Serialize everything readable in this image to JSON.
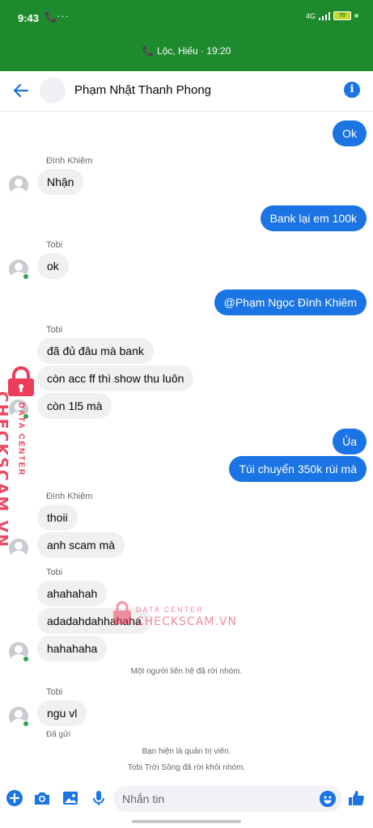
{
  "status_bar": {
    "time": "9:43",
    "network": "4G",
    "battery": "70"
  },
  "call_banner": {
    "text": "Lộc, Hiếu · 19:20"
  },
  "header": {
    "title": "Phạm Nhật Thanh Phong",
    "icons": [
      "back-arrow-icon",
      "info-icon"
    ]
  },
  "messages": [
    {
      "side": "out",
      "text": "Ok"
    },
    {
      "side": "in",
      "sender": "Đình Khiêm",
      "text": "Nhận"
    },
    {
      "side": "out",
      "text": "Bank lại em 100k"
    },
    {
      "side": "in",
      "sender": "Tobi",
      "text": "ok"
    },
    {
      "side": "out",
      "text": "@Phạm Ngọc Đình Khiêm"
    },
    {
      "side": "in",
      "sender": "Tobi",
      "text": "đã đủ đâu mà bank"
    },
    {
      "side": "in",
      "text": "còn acc ff thì show thu luôn"
    },
    {
      "side": "in",
      "text": "còn 1l5 mà"
    },
    {
      "side": "out",
      "text": "Ủa"
    },
    {
      "side": "out",
      "text": "Túi chuyển 350k rùi mà"
    },
    {
      "side": "in",
      "sender": "Đình Khiêm",
      "text": "thoii"
    },
    {
      "side": "in",
      "text": "anh scam mà"
    },
    {
      "side": "in",
      "sender": "Tobi",
      "text": "ahahahah"
    },
    {
      "side": "in",
      "text": "adadahdahhahaha"
    },
    {
      "side": "in",
      "text": "hahahaha"
    },
    {
      "side": "in",
      "sender": "Tobi",
      "text": "ngu vl"
    }
  ],
  "system_notices": {
    "left_group": "Một người liên hệ đã rời nhóm.",
    "admin": "Bạn hiện là quản trị viên.",
    "left_named": "Tobi Trời Sông đã rời khỏi nhóm."
  },
  "seen_label": "Đã gửi",
  "composer": {
    "placeholder": "Nhắn tin",
    "icons": [
      "plus-icon",
      "camera-icon",
      "image-icon",
      "mic-icon",
      "emoji-icon",
      "like-icon"
    ]
  },
  "watermark": {
    "small": "DATA CENTER",
    "big": "CHECKSCAM.VN"
  },
  "colors": {
    "status_bar": "#1e8a2e",
    "outgoing_bubble": "#1b74e4",
    "incoming_bubble": "#f0f0f0",
    "watermark": "#ec3d5a"
  }
}
